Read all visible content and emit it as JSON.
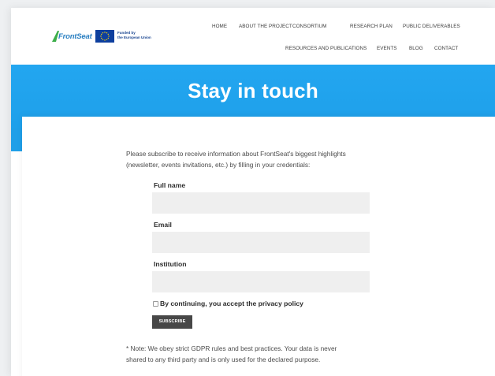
{
  "header": {
    "logo_text": "FrontSeat",
    "eu_text_line1": "Funded by",
    "eu_text_line2": "the European Union",
    "nav_row1": [
      "HOME",
      "ABOUT THE PROJECT",
      "CONSORTIUM",
      "RESEARCH PLAN",
      "PUBLIC DELIVERABLES"
    ],
    "nav_row2": [
      "RESOURCES AND PUBLICATIONS",
      "EVENTS",
      "BLOG",
      "CONTACT"
    ]
  },
  "hero": {
    "title": "Stay in touch"
  },
  "form": {
    "intro_line1": "Please subscribe to receive information about FrontSeat's biggest highlights",
    "intro_line2": "(newsletter, events invitations, etc.) by filling in your credentials:",
    "full_name_label": "Full name",
    "email_label": "Email",
    "institution_label": "Institution",
    "full_name_value": "",
    "email_value": "",
    "institution_value": "",
    "privacy_label": "By continuing, you accept the privacy policy",
    "privacy_checked": false,
    "subscribe_label": "SUBSCRIBE",
    "note_line1": "* Note: We obey strict GDPR rules and best practices. Your data is never",
    "note_line2": "shared to any third party and is only used for the declared purpose."
  },
  "colors": {
    "hero_blue": "#1ea0ea",
    "logo_blue": "#2a7fc1",
    "logo_green": "#3cae4a",
    "eu_blue": "#0d3f9e",
    "eu_star": "#ffd400",
    "button_dark": "#474747",
    "field_gray": "#efefef"
  }
}
